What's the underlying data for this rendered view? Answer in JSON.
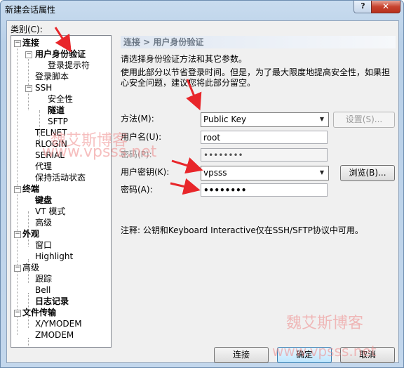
{
  "window": {
    "title": "新建会话属性",
    "help_glyph": "?",
    "close_glyph": "✕"
  },
  "category": {
    "label": "类别(C):"
  },
  "tree": {
    "connection": "连接",
    "user_auth": "用户身份验证",
    "login_prompt": "登录提示符",
    "login_script": "登录脚本",
    "ssh": "SSH",
    "security": "安全性",
    "tunnel": "隧道",
    "sftp": "SFTP",
    "telnet": "TELNET",
    "rlogin": "RLOGIN",
    "serial": "SERIAL",
    "proxy": "代理",
    "keepalive": "保持活动状态",
    "terminal": "终端",
    "keyboard": "键盘",
    "vt_mode": "VT 模式",
    "advanced1": "高级",
    "appearance": "外观",
    "window": "窗口",
    "highlight": "Highlight",
    "advanced2": "高级",
    "trace": "跟踪",
    "bell": "Bell",
    "log": "日志记录",
    "file_transfer": "文件传输",
    "xymodem": "X/YMODEM",
    "zmodem": "ZMODEM"
  },
  "panel": {
    "header": "连接 > 用户身份验证",
    "desc_line1": "请选择身份验证方法和其它参数。",
    "desc_line2": "使用此部分以节省登录时间。但是，为了最大限度地提高安全性，如果担",
    "desc_line3": "心安全问题，建议您将此部分留空。",
    "method_label": "方法(M):",
    "method_value": "Public Key",
    "settings_button": "设置(S)...",
    "username_label": "用户名(U):",
    "username_value": "root",
    "password_label_disabled": "密码(P):",
    "password_disabled_value": "••••••••",
    "userkey_label": "用户密钥(K):",
    "userkey_value": "vpsss",
    "browse_button": "浏览(B)...",
    "passphrase_label": "密码(A):",
    "passphrase_value": "••••••••",
    "note": "注释: 公钥和Keyboard Interactive仅在SSH/SFTP协议中可用。"
  },
  "buttons": {
    "connect": "连接",
    "ok": "确定",
    "cancel": "取消"
  },
  "watermarks": {
    "mid_text": "魏艾斯博客",
    "mid_url": "www.vpsss.net",
    "corner_text": "魏艾斯博客",
    "corner_url": "www.vpsss.net"
  },
  "colors": {
    "annotation_arrow": "#e8262a",
    "watermark": "#ef8a8a"
  }
}
